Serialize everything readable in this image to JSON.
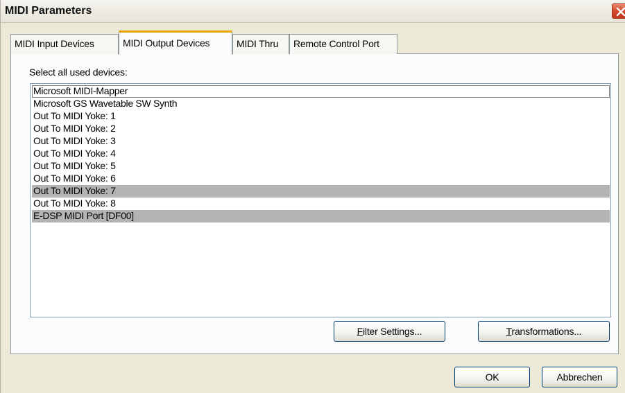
{
  "window": {
    "title": "MIDI Parameters",
    "close_icon": "close-icon"
  },
  "tabs": [
    {
      "label": "MIDI Input Devices",
      "active": false
    },
    {
      "label": "MIDI Output Devices",
      "active": true
    },
    {
      "label": "MIDI Thru",
      "active": false
    },
    {
      "label": "Remote Control Port",
      "active": false
    }
  ],
  "output": {
    "list_label": "Select all used devices:",
    "devices": [
      {
        "label": "Microsoft MIDI-Mapper",
        "selected": false,
        "focused": true
      },
      {
        "label": "Microsoft GS Wavetable SW Synth",
        "selected": false,
        "focused": false
      },
      {
        "label": "Out To MIDI Yoke:  1",
        "selected": false,
        "focused": false
      },
      {
        "label": "Out To MIDI Yoke:  2",
        "selected": false,
        "focused": false
      },
      {
        "label": "Out To MIDI Yoke:  3",
        "selected": false,
        "focused": false
      },
      {
        "label": "Out To MIDI Yoke:  4",
        "selected": false,
        "focused": false
      },
      {
        "label": "Out To MIDI Yoke:  5",
        "selected": false,
        "focused": false
      },
      {
        "label": "Out To MIDI Yoke:  6",
        "selected": false,
        "focused": false
      },
      {
        "label": "Out To MIDI Yoke:  7",
        "selected": true,
        "focused": false
      },
      {
        "label": "Out To MIDI Yoke:  8",
        "selected": false,
        "focused": false
      },
      {
        "label": "E-DSP MIDI Port [DF00]",
        "selected": true,
        "focused": false
      }
    ],
    "filter_button": {
      "mnemonic": "F",
      "rest": "ilter Settings..."
    },
    "transform_button": {
      "mnemonic": "T",
      "rest": "ransformations..."
    }
  },
  "footer": {
    "ok_label": "OK",
    "cancel_label": "Abbrechen"
  }
}
